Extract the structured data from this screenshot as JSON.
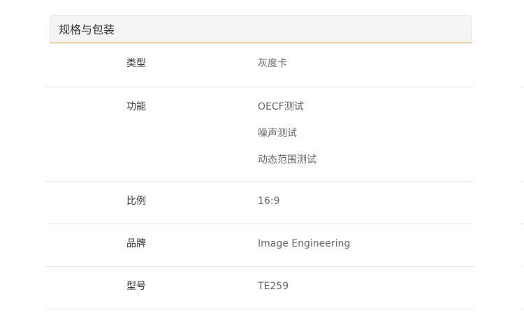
{
  "section": {
    "title": "规格与包装"
  },
  "specs": [
    {
      "label": "类型",
      "values": [
        "灰度卡"
      ]
    },
    {
      "label": "功能",
      "values": [
        "OECF测试",
        "噪声测试",
        "动态范围测试"
      ]
    },
    {
      "label": "比例",
      "values": [
        "16:9"
      ]
    },
    {
      "label": "品牌",
      "values": [
        "Image Engineering"
      ]
    },
    {
      "label": "型号",
      "values": [
        "TE259"
      ]
    }
  ]
}
